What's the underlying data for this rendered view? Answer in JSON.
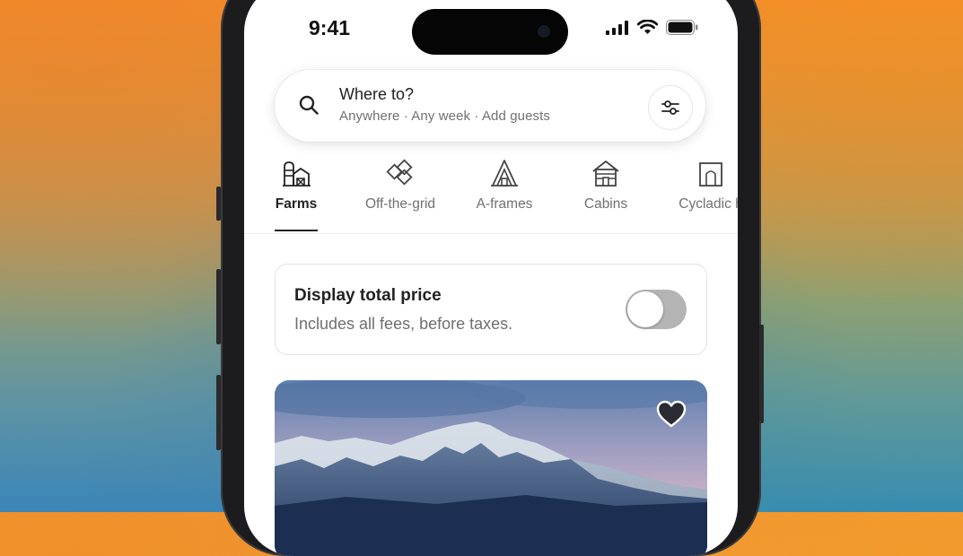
{
  "status_bar": {
    "time": "9:41",
    "icons": [
      "cellular-signal-icon",
      "wifi-icon",
      "battery-icon"
    ]
  },
  "search": {
    "title": "Where to?",
    "subtitle": "Anywhere · Any week · Add guests",
    "icon": "search-icon",
    "filter_icon": "filters-icon"
  },
  "categories": [
    {
      "label": "Farms",
      "icon": "barn-icon",
      "active": true
    },
    {
      "label": "Off-the-grid",
      "icon": "diamonds-icon",
      "active": false
    },
    {
      "label": "A-frames",
      "icon": "a-frame-icon",
      "active": false
    },
    {
      "label": "Cabins",
      "icon": "cabin-icon",
      "active": false
    },
    {
      "label": "Cycladic h",
      "icon": "cycladic-home-icon",
      "active": false
    }
  ],
  "price_toggle": {
    "title": "Display total price",
    "subtitle": "Includes all fees, before taxes.",
    "enabled": false
  },
  "listing": {
    "image": "snowy-mountain-photo",
    "favorite_icon": "heart-icon"
  },
  "colors": {
    "text_primary": "#222222",
    "text_secondary": "#717171",
    "toggle_off": "#b4b4b4"
  }
}
